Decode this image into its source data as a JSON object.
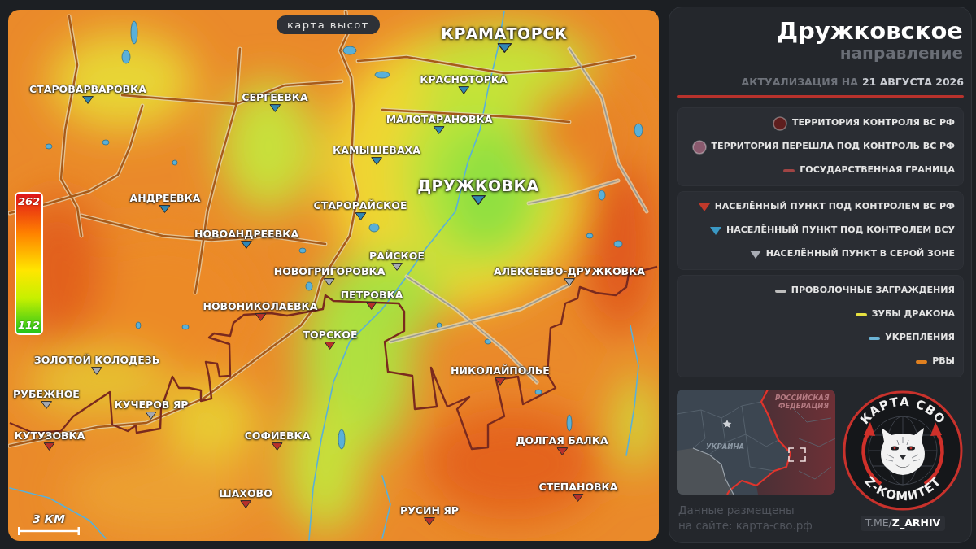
{
  "map": {
    "mode_label": "карта высот",
    "elevation_scale": {
      "max": "262",
      "min": "112"
    },
    "towns": [
      {
        "name": "КРАМАТОРСК",
        "kind": "ua",
        "major": true
      },
      {
        "name": "КРАСНОТОРКА",
        "kind": "ua",
        "major": false
      },
      {
        "name": "СТАРОВАРВАРОВКА",
        "kind": "ua",
        "major": false
      },
      {
        "name": "СЕРГЕЕВКА",
        "kind": "ua",
        "major": false
      },
      {
        "name": "МАЛОТАРАНОВКА",
        "kind": "ua",
        "major": false
      },
      {
        "name": "КАМЫШЕВАХА",
        "kind": "ua",
        "major": false
      },
      {
        "name": "ДРУЖКОВКА",
        "kind": "ua",
        "major": true
      },
      {
        "name": "АНДРЕЕВКА",
        "kind": "ua",
        "major": false
      },
      {
        "name": "СТАРОРАЙСКОЕ",
        "kind": "ua",
        "major": false
      },
      {
        "name": "НОВОАНДРЕЕВКА",
        "kind": "ua",
        "major": false
      },
      {
        "name": "РАЙСКОЕ",
        "kind": "gray",
        "major": false
      },
      {
        "name": "НОВОГРИГОРОВКА",
        "kind": "gray",
        "major": false
      },
      {
        "name": "АЛЕКСЕЕВО-ДРУЖКОВКА",
        "kind": "gray",
        "major": false
      },
      {
        "name": "ПЕТРОВКА",
        "kind": "ru",
        "major": false
      },
      {
        "name": "НОВОНИКОЛАЕВКА",
        "kind": "ru",
        "major": false
      },
      {
        "name": "ТОРСКОЕ",
        "kind": "ru",
        "major": false
      },
      {
        "name": "ЗОЛОТОЙ КОЛОДЕЗЬ",
        "kind": "gray",
        "major": false
      },
      {
        "name": "НИКОЛАЙПОЛЬЕ",
        "kind": "ru",
        "major": false
      },
      {
        "name": "РУБЕЖНОЕ",
        "kind": "gray",
        "major": false
      },
      {
        "name": "КУЧЕРОВ ЯР",
        "kind": "gray",
        "major": false
      },
      {
        "name": "КУТУЗОВКА",
        "kind": "ru",
        "major": false
      },
      {
        "name": "СОФИЕВКА",
        "kind": "ru",
        "major": false
      },
      {
        "name": "ДОЛГАЯ БАЛКА",
        "kind": "ru",
        "major": false
      },
      {
        "name": "СТЕПАНОВКА",
        "kind": "ru",
        "major": false
      },
      {
        "name": "ШАХОВО",
        "kind": "ru",
        "major": false
      },
      {
        "name": "РУСИН ЯР",
        "kind": "ru",
        "major": false
      }
    ],
    "scale": "3 КМ"
  },
  "sidebar": {
    "title": "Дружковское",
    "subtitle": "направление",
    "update_label": "АКТУАЛИЗАЦИЯ НА",
    "update_date": "21 АВГУСТА 2026",
    "legend": [
      {
        "items": [
          {
            "label": "ТЕРРИТОРИЯ КОНТРОЛЯ ВС РФ",
            "kind": "circle",
            "color": "#5e1e1e"
          },
          {
            "label": "ТЕРРИТОРИЯ ПЕРЕШЛА ПОД КОНТРОЛЬ ВС РФ",
            "kind": "circle",
            "color": "#8a5a6e"
          },
          {
            "label": "ГОСУДАРСТВЕННАЯ ГРАНИЦА",
            "kind": "line",
            "color": "#a04444"
          }
        ]
      },
      {
        "items": [
          {
            "label": "НАСЕЛЁННЫЙ ПУНКТ ПОД КОНТРОЛЕМ ВС РФ",
            "kind": "triangle",
            "color": "#c0392b"
          },
          {
            "label": "НАСЕЛЁННЫЙ ПУНКТ ПОД КОНТРОЛЕМ ВСУ",
            "kind": "triangle",
            "color": "#3a98c4"
          },
          {
            "label": "НАСЕЛЁННЫЙ ПУНКТ В СЕРОЙ ЗОНЕ",
            "kind": "triangle",
            "color": "#a8acb4"
          }
        ]
      },
      {
        "items": [
          {
            "label": "ПРОВОЛОЧНЫЕ ЗАГРАЖДЕНИЯ",
            "kind": "line",
            "color": "#bdbdbd"
          },
          {
            "label": "ЗУБЫ ДРАКОНА",
            "kind": "line",
            "color": "#e6e040"
          },
          {
            "label": "УКРЕПЛЕНИЯ",
            "kind": "line",
            "color": "#6cb4d6"
          },
          {
            "label": "РВЫ",
            "kind": "line",
            "color": "#e08020"
          }
        ]
      }
    ],
    "overview_map": {
      "russia_label": "РОССИЙСКАЯ ФЕДЕРАЦИЯ",
      "ukraine_label": "УКРАИНА"
    },
    "source_note": [
      "Данные размещены",
      "на сайте: карта-сво.рф"
    ],
    "logo": {
      "top_text": "КАРТА СВО",
      "bottom_text": "Z-КОМИТЕТ"
    },
    "channel": "T.ME/**Z_ARHIV**"
  }
}
